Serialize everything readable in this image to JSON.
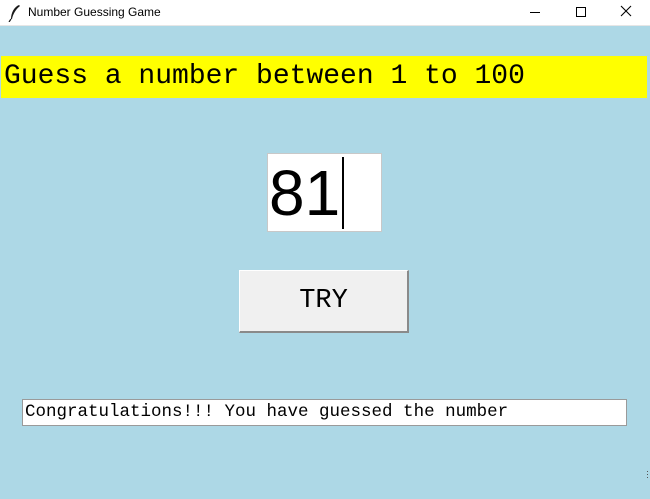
{
  "window": {
    "title": "Number Guessing Game",
    "app_icon": "feather-icon",
    "controls": [
      "minimize-icon",
      "maximize-icon",
      "close-icon"
    ]
  },
  "prompt": {
    "text": "Guess a number between 1 to 100"
  },
  "guess": {
    "value": "81"
  },
  "try_button": {
    "label": "TRY"
  },
  "result": {
    "message": "Congratulations!!! You have guessed the number"
  },
  "colors": {
    "background": "#add8e6",
    "banner": "#ffff00",
    "button": "#f0f0f0"
  }
}
